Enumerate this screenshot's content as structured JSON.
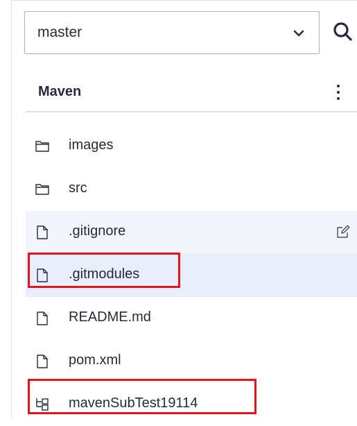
{
  "branch_selector": {
    "value": "master",
    "chevron_icon": "chevron-down-icon"
  },
  "search": {
    "icon": "search-icon"
  },
  "repo_header": {
    "title": "Maven",
    "more_icon": "more-vertical-icon"
  },
  "files": [
    {
      "name": "images",
      "type": "folder",
      "icon": "folder-icon"
    },
    {
      "name": "src",
      "type": "folder",
      "icon": "folder-icon"
    },
    {
      "name": ".gitignore",
      "type": "file",
      "icon": "file-icon",
      "state": "hover",
      "action_icon": "edit-icon"
    },
    {
      "name": ".gitmodules",
      "type": "file",
      "icon": "file-icon",
      "state": "selected",
      "highlighted": true
    },
    {
      "name": "README.md",
      "type": "file",
      "icon": "file-icon"
    },
    {
      "name": "pom.xml",
      "type": "file",
      "icon": "file-icon"
    },
    {
      "name": "mavenSubTest19114",
      "type": "submodule",
      "icon": "submodule-icon",
      "highlighted": true
    }
  ],
  "colors": {
    "highlight": "#e3141e",
    "selected_row": "#e9eefb",
    "hover_row": "#f2f5fc",
    "text": "#252b3a",
    "border": "#dfe1e6"
  }
}
